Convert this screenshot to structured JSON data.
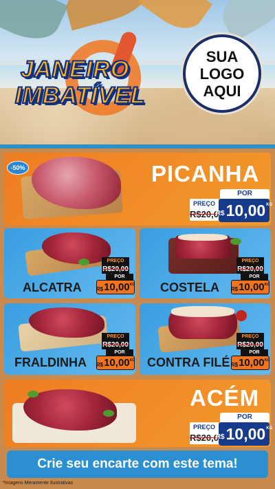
{
  "header": {
    "title_line1": "JANEIRO",
    "title_line2": "IMBATÍVEL",
    "logo_line1": "SUA",
    "logo_line2": "LOGO",
    "logo_line3": "AQUI"
  },
  "featured": [
    {
      "name": "PICANHA",
      "badge": "-50%",
      "old_label": "PREÇO",
      "old_price": "R$20,00",
      "por_label": "POR",
      "currency": "R$",
      "new_price": "10,00",
      "unit": "KG"
    },
    {
      "name": "ACÉM",
      "old_label": "PREÇO",
      "old_price": "R$20,00",
      "por_label": "POR",
      "currency": "R$",
      "new_price": "10,00",
      "unit": "KG"
    }
  ],
  "products": [
    {
      "name": "ALCATRA",
      "old_label": "PREÇO",
      "old_price": "R$20,00",
      "por_label": "POR",
      "currency": "R$",
      "new_price": "10,00",
      "unit": "KG"
    },
    {
      "name": "COSTELA",
      "old_label": "PREÇO",
      "old_price": "R$20,00",
      "por_label": "POR",
      "currency": "R$",
      "new_price": "10,00",
      "unit": "KG"
    },
    {
      "name": "FRALDINHA",
      "old_label": "PREÇO",
      "old_price": "R$20,00",
      "por_label": "POR",
      "currency": "R$",
      "new_price": "10,00",
      "unit": "KG"
    },
    {
      "name": "CONTRA FILÉ",
      "old_label": "PREÇO",
      "old_price": "R$20,00",
      "por_label": "POR",
      "currency": "R$",
      "new_price": "10,00",
      "unit": "KG"
    }
  ],
  "footer": {
    "cta": "Crie seu encarte com este tema!",
    "note": "*Imagens Meramente Ilustrativas"
  },
  "colors": {
    "orange": "#ee7d22",
    "blue": "#3a9de0",
    "navy": "#173b8c",
    "wood": "#c98a4f"
  }
}
